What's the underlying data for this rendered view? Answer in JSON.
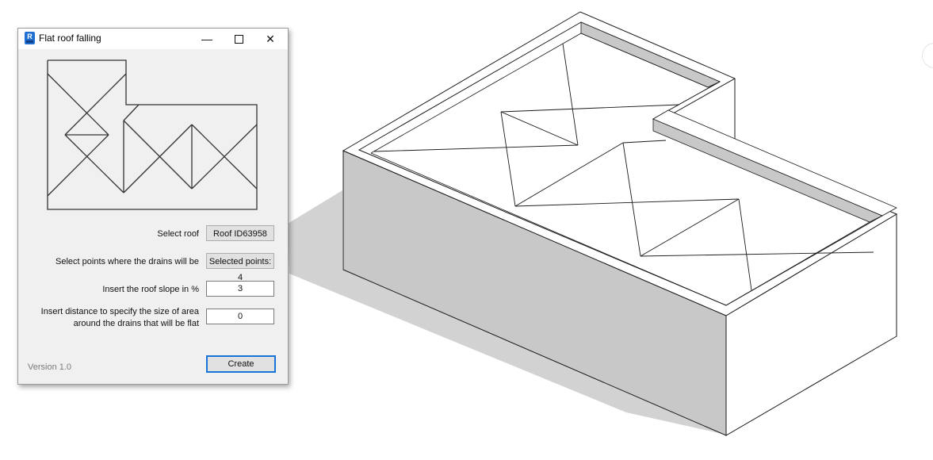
{
  "window": {
    "title": "Flat roof falling",
    "app_icon": "revit-addin-icon",
    "controls": {
      "minimize": "—",
      "maximize": "maximize-icon",
      "close": "✕"
    }
  },
  "form": {
    "select_roof": {
      "label": "Select roof",
      "button": "Roof ID63958"
    },
    "select_points": {
      "label": "Select points where the drains will be",
      "button": "Selected points: 4"
    },
    "roof_slope": {
      "label": "Insert the roof slope in %",
      "value": "3"
    },
    "flat_distance": {
      "label_line1": "Insert distance to specify the size of area",
      "label_line2": "around the drains that will be flat",
      "value": "0"
    }
  },
  "footer": {
    "version": "Version 1.0",
    "create_button": "Create"
  },
  "preview": {
    "description": "L-shaped flat roof plan with drain slope lines",
    "drain_count": 4
  },
  "model_view": {
    "description": "3D isometric view of L-shaped building with sloped flat roof and parapet",
    "wall_shade": "#c8c8c8",
    "shadow": "#cfcfcf",
    "line": "#1a1a1a"
  }
}
